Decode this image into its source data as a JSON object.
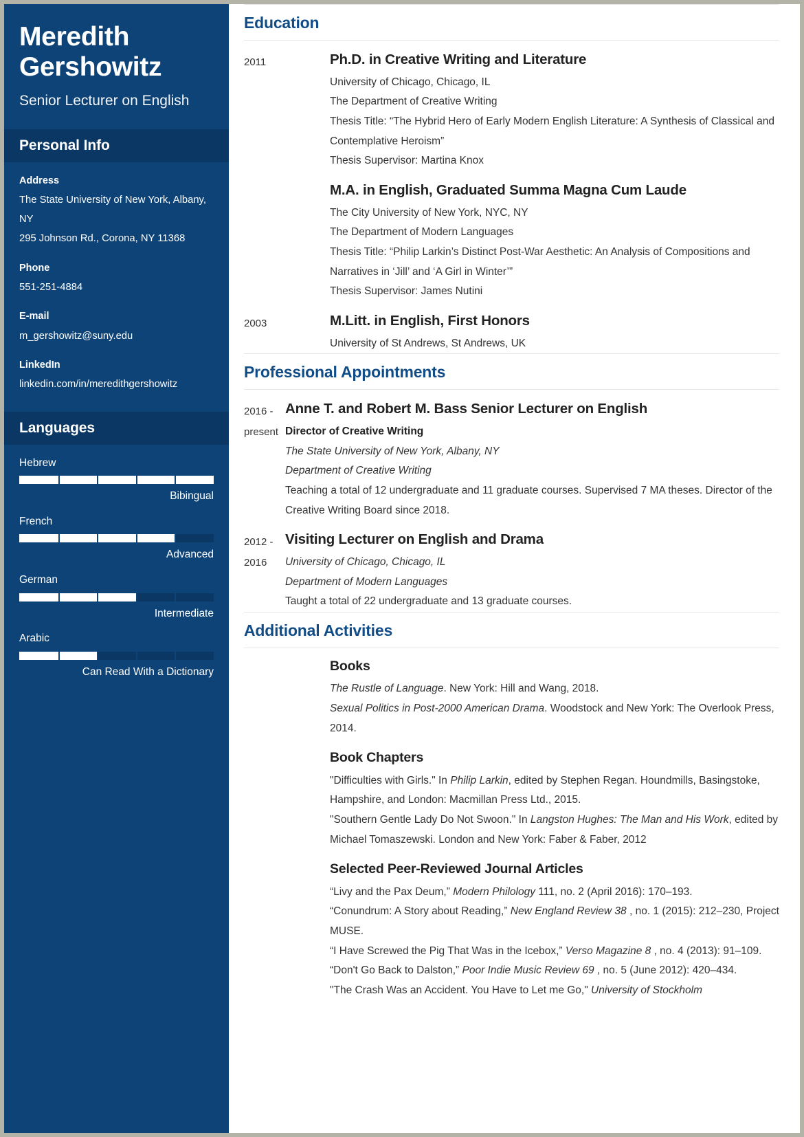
{
  "sidebar": {
    "name": "Meredith Gershowitz",
    "job_title": "Senior Lecturer on English",
    "personal_info_header": "Personal Info",
    "info_items": [
      {
        "label": "Address",
        "values": [
          "The State University of New York, Albany, NY",
          "295 Johnson Rd., Corona, NY 11368"
        ]
      },
      {
        "label": "Phone",
        "values": [
          "551-251-4884"
        ]
      },
      {
        "label": "E-mail",
        "values": [
          "m_gershowitz@suny.edu"
        ]
      },
      {
        "label": "LinkedIn",
        "values": [
          "linkedin.com/in/meredithgershowitz"
        ]
      }
    ],
    "languages_header": "Languages",
    "languages": [
      {
        "name": "Hebrew",
        "level": "Bibingual",
        "percent": 100
      },
      {
        "name": "French",
        "level": "Advanced",
        "percent": 80
      },
      {
        "name": "German",
        "level": "Intermediate",
        "percent": 60
      },
      {
        "name": "Arabic",
        "level": "Can Read With a Dictionary",
        "percent": 40
      }
    ]
  },
  "main": {
    "education": {
      "title": "Education",
      "entries": [
        {
          "date": "2011",
          "title": "Ph.D. in Creative Writing and Literature",
          "lines": [
            "University of Chicago, Chicago, IL",
            "The Department of Creative Writing",
            "Thesis Title: “The Hybrid Hero of Early Modern English Literature: A Synthesis of Classical and Contemplative Heroism”",
            "Thesis Supervisor: Martina Knox"
          ]
        },
        {
          "date": "",
          "title": "M.A. in English, Graduated Summa Magna Cum Laude",
          "lines": [
            "The City University of New York, NYC, NY",
            "The Department of Modern Languages",
            "Thesis Title: “Philip Larkin’s Distinct Post-War Aesthetic: An Analysis of Compositions and Narratives in ‘Jill’ and ‘A Girl in Winter’”",
            "Thesis Supervisor: James Nutini"
          ]
        },
        {
          "date": "2003",
          "title": "M.Litt. in English, First Honors",
          "lines": [
            "University of St Andrews, St Andrews, UK"
          ]
        }
      ]
    },
    "appointments": {
      "title": "Professional Appointments",
      "entries": [
        {
          "date": "2016 - present",
          "title": "Anne T. and Robert M. Bass Senior Lecturer on English",
          "subtitle": "Director of Creative Writing",
          "italic_lines": [
            "The State University of New York, Albany, NY",
            "Department of Creative Writing"
          ],
          "lines": [
            "Teaching a total of 12 undergraduate and 11 graduate courses. Supervised 7 MA theses. Director of the Creative Writing Board since 2018."
          ]
        },
        {
          "date": "2012 - 2016",
          "title": "Visiting Lecturer on English and Drama",
          "subtitle": "",
          "italic_lines": [
            "University of Chicago, Chicago, IL",
            "Department of Modern Languages"
          ],
          "lines": [
            "Taught a total of 22 undergraduate and 13 graduate courses."
          ]
        }
      ]
    },
    "activities": {
      "title": "Additional Activities",
      "groups": [
        {
          "heading": "Books",
          "items_html": [
            "<em>The Rustle of Language</em>. New York: Hill and Wang, 2018.",
            "<em>Sexual Politics in Post-2000 American Drama</em>. Woodstock and New York: The Overlook Press, 2014."
          ]
        },
        {
          "heading": "Book Chapters",
          "items_html": [
            "\"Difficulties with Girls.\" In <em>Philip Larkin</em>, edited by Stephen Regan. Houndmills, Basingstoke, Hampshire, and London: Macmillan Press Ltd., 2015.",
            "\"Southern Gentle Lady Do Not Swoon.\" In <em>Langston Hughes: The Man and His Work</em>, edited by Michael Tomaszewski. London and New York: Faber &amp; Faber, 2012"
          ]
        },
        {
          "heading": "Selected Peer-Reviewed Journal Articles",
          "items_html": [
            "“Livy and the Pax Deum,” <em>Modern Philology</em> 111, no. 2 (April 2016): 170–193.",
            "“Conundrum: A Story about Reading,” <em>New England Review 38</em> , no. 1 (2015): 212–230, Project MUSE.",
            "“I Have Screwed the Pig That Was in the Icebox,” <em>Verso Magazine 8</em> , no. 4 (2013): 91–109.",
            "“Don't Go Back to Dalston,” <em>Poor Indie Music Review 69</em> , no. 5 (June 2012): 420–434.",
            "\"The Crash Was an Accident. You Have to Let me Go,\" <em>University of Stockholm</em>"
          ]
        }
      ]
    }
  },
  "colors": {
    "sidebar_bg": "#0e4377",
    "sidebar_header_bg": "#0a3763",
    "accent_heading": "#124c86",
    "page_border": "#b3b3a8"
  }
}
